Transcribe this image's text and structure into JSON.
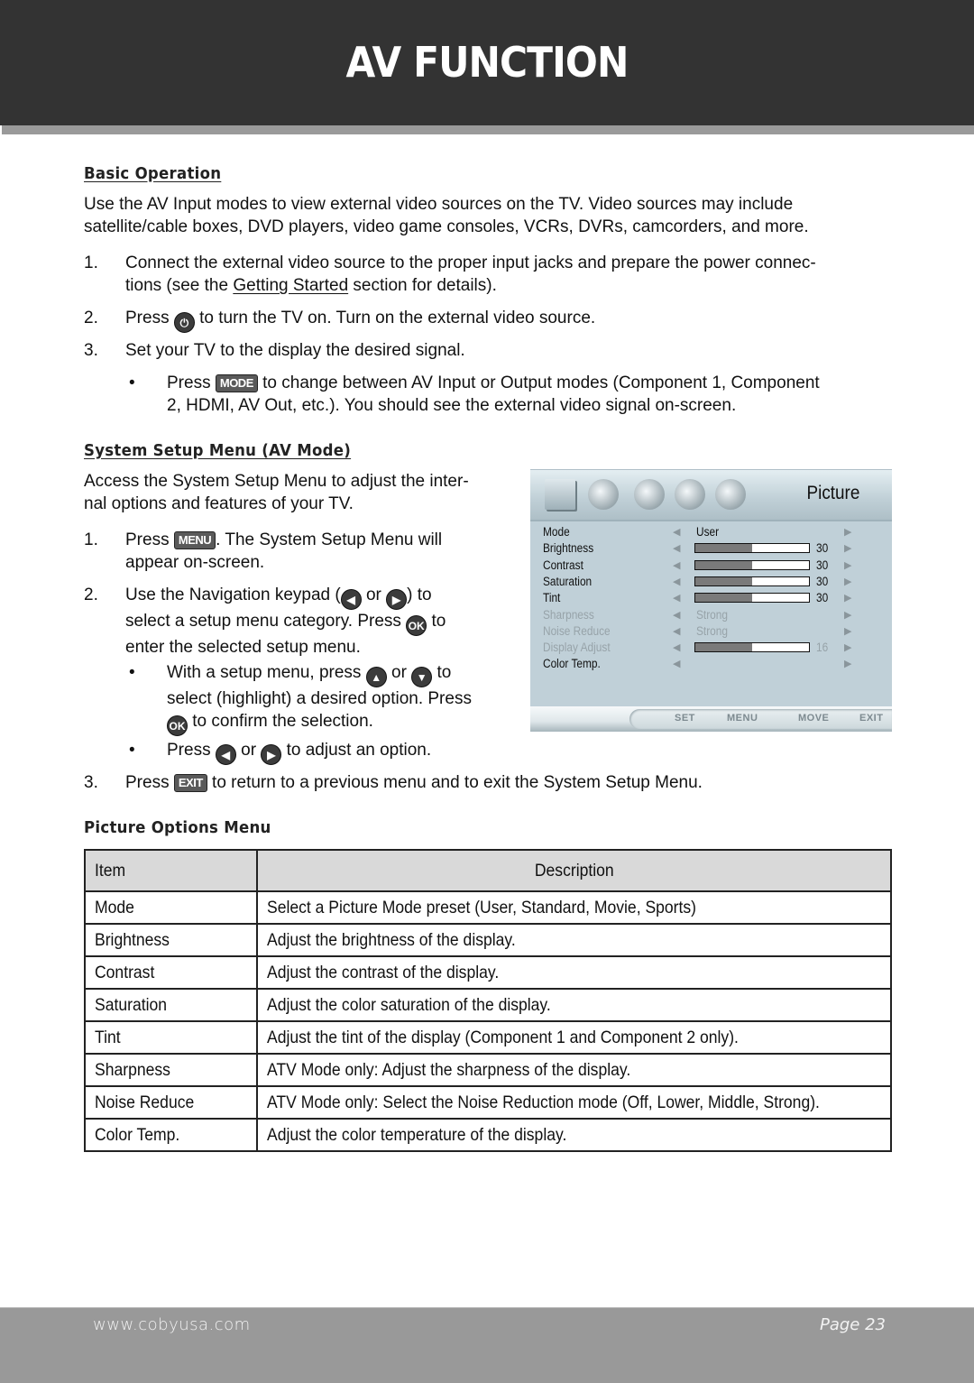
{
  "header": {
    "title": "AV FUNCTION"
  },
  "basic_operation": {
    "heading": "Basic Operation",
    "intro_line1": "Use the AV Input modes to view external video sources on the TV. Video sources may include",
    "intro_line2": "satellite/cable boxes, DVD players, video game consoles, VCRs, DVRs, camcorders, and more.",
    "steps": [
      {
        "num": "1.",
        "line1": "Connect the external video source to the proper input jacks and prepare the power connec-",
        "line2_pre": "tions (see the ",
        "link": "Getting Started",
        "line2_post": " section for details)."
      },
      {
        "num": "2.",
        "pre": "Press ",
        "key_icon": "power-icon",
        "post": " to turn the TV on. Turn on the external video source."
      },
      {
        "num": "3.",
        "text": "Set your TV to the display the desired signal."
      }
    ],
    "bullet": {
      "pre": "Press ",
      "key": "MODE",
      "post_line1": " to change between AV Input or Output modes (Component 1, Component",
      "line2": "2, HDMI, AV Out, etc.). You should see the external video signal on-screen."
    }
  },
  "system_setup": {
    "heading": "System Setup Menu (AV Mode)",
    "intro_line1": "Access the System Setup Menu to adjust the inter-",
    "intro_line2": "nal options and features of your TV.",
    "step1": {
      "num": "1.",
      "pre": "Press ",
      "key": "MENU",
      "post": ". The System Setup Menu will",
      "line2": "appear on-screen."
    },
    "step2": {
      "num": "2.",
      "l1_pre": "Use the Navigation keypad (",
      "or": " or ",
      "l1_post": ") to",
      "l2_pre": "select a setup menu category. Press ",
      "ok": "OK",
      "l2_post": " to",
      "line3": "enter the selected setup menu."
    },
    "bullet1": {
      "pre": "With a setup menu, press ",
      "or": " or ",
      "post": " to",
      "line2": "select (highlight) a desired option. Press",
      "ok": "OK",
      "line3": " to confirm the selection."
    },
    "bullet2": {
      "pre": "Press ",
      "or": " or ",
      "post": " to adjust an option."
    },
    "step3": {
      "num": "3.",
      "pre": "Press ",
      "key": "EXIT",
      "post": " to return to a previous menu and to exit the System Setup Menu."
    }
  },
  "tv_menu": {
    "tabs": [
      "picture-tab-icon",
      "sound-tab-icon",
      "time-tab-icon",
      "setup-tab-icon",
      "lock-tab-icon"
    ],
    "title": "Picture",
    "rows": [
      {
        "label": "Mode",
        "value": "User",
        "dim": false
      },
      {
        "label": "Brightness",
        "level": 30,
        "max": 60,
        "number": "30",
        "dim": false
      },
      {
        "label": "Contrast",
        "level": 30,
        "max": 60,
        "number": "30",
        "dim": false
      },
      {
        "label": "Saturation",
        "level": 30,
        "max": 60,
        "number": "30",
        "dim": false
      },
      {
        "label": "Tint",
        "level": 30,
        "max": 60,
        "number": "30",
        "dim": false
      },
      {
        "label": "Sharpness",
        "value": "Strong",
        "dim": true
      },
      {
        "label": "Noise Reduce",
        "value": "Strong",
        "dim": true
      },
      {
        "label": "Display Adjust",
        "level": 16,
        "max": 32,
        "number": "16",
        "dim": true
      },
      {
        "label": "Color Temp.",
        "dim": false
      }
    ],
    "footer": [
      "SET",
      "MENU",
      "MOVE",
      "EXIT"
    ]
  },
  "picture_options": {
    "heading": "Picture Options Menu",
    "columns": [
      "Item",
      "Description"
    ],
    "rows": [
      [
        "Mode",
        "Select a Picture Mode preset (User, Standard, Movie, Sports)"
      ],
      [
        "Brightness",
        "Adjust the brightness of the display."
      ],
      [
        "Contrast",
        "Adjust the contrast of the display."
      ],
      [
        "Saturation",
        "Adjust the color saturation of the display."
      ],
      [
        "Tint",
        "Adjust the tint of the display (Component 1 and Component 2 only)."
      ],
      [
        "Sharpness",
        "ATV Mode only: Adjust the sharpness of the display."
      ],
      [
        "Noise Reduce",
        "ATV Mode only: Select the Noise Reduction mode (Off, Lower, Middle, Strong)."
      ],
      [
        "Color Temp.",
        "Adjust the color temperature of the display."
      ]
    ]
  },
  "footer": {
    "url": "www.cobyusa.com",
    "page": "Page 23"
  }
}
